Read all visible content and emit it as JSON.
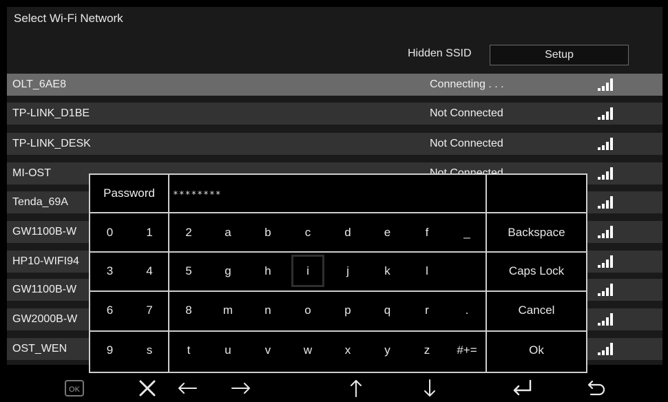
{
  "header": {
    "title": "Select Wi-Fi Network",
    "hidden_ssid_label": "Hidden SSID",
    "setup_label": "Setup"
  },
  "networks": [
    {
      "ssid": "OLT_6AE8",
      "status": "Connecting . . .",
      "selected": true,
      "signal_icon": "signal-bars-icon"
    },
    {
      "ssid": "TP-LINK_D1BE",
      "status": "Not Connected",
      "signal_icon": "signal-bars-icon"
    },
    {
      "ssid": "TP-LINK_DESK",
      "status": "Not Connected",
      "signal_icon": "signal-bars-icon"
    },
    {
      "ssid": "MI-OST",
      "status": "Not Connected",
      "signal_icon": "signal-bars-icon"
    },
    {
      "ssid": "Tenda_69A",
      "status": "",
      "signal_icon": "signal-bars-icon"
    },
    {
      "ssid": "GW1100B-W",
      "status": "",
      "signal_icon": "signal-bars-icon"
    },
    {
      "ssid": "HP10-WIFI94",
      "status": "",
      "signal_icon": "signal-bars-icon"
    },
    {
      "ssid": "GW1100B-W",
      "status": "",
      "signal_icon": "signal-bars-icon"
    },
    {
      "ssid": "GW2000B-W",
      "status": "",
      "signal_icon": "signal-bars-icon"
    },
    {
      "ssid": "OST_WEN",
      "status": "",
      "signal_icon": "signal-bars-icon"
    }
  ],
  "keyboard": {
    "password_label": "Password",
    "password_value": "********",
    "rows": [
      [
        "0",
        "1",
        "2",
        "a",
        "b",
        "c",
        "d",
        "e",
        "f",
        "_"
      ],
      [
        "3",
        "4",
        "5",
        "g",
        "h",
        "i",
        "j",
        "k",
        "l",
        ""
      ],
      [
        "6",
        "7",
        "8",
        "m",
        "n",
        "o",
        "p",
        "q",
        "r",
        "."
      ],
      [
        "9",
        "s",
        "t",
        "u",
        "v",
        "w",
        "x",
        "y",
        "z",
        "#+="
      ]
    ],
    "actions": [
      "Backspace",
      "Caps Lock",
      "Cancel",
      "Ok"
    ],
    "focused_key": "i"
  },
  "bottom_bar": {
    "buttons": [
      {
        "name": "ok-button",
        "icon": "ok-icon",
        "text": "OK"
      },
      {
        "name": "close-button",
        "icon": "close-icon"
      },
      {
        "name": "left-arrow-button",
        "icon": "arrow-left-icon"
      },
      {
        "name": "right-arrow-button",
        "icon": "arrow-right-icon"
      },
      {
        "name": "up-arrow-button",
        "icon": "arrow-up-icon"
      },
      {
        "name": "down-arrow-button",
        "icon": "arrow-down-icon"
      },
      {
        "name": "enter-button",
        "icon": "enter-icon"
      },
      {
        "name": "back-button",
        "icon": "back-icon"
      }
    ]
  },
  "colors": {
    "background": "#000000",
    "panel": "#1a1a1a",
    "row": "#333333",
    "row_selected": "#6a6a6a",
    "text": "#e8e8e8"
  }
}
